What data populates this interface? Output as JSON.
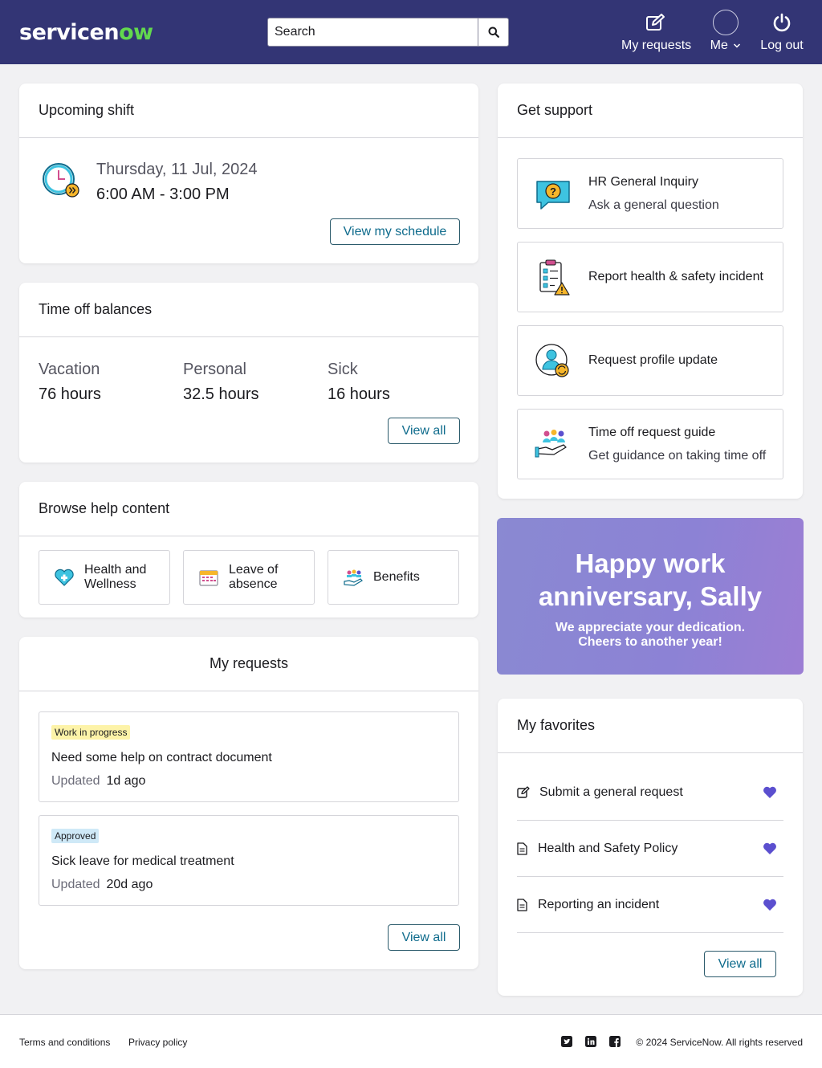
{
  "header": {
    "logo_main": "servicen",
    "logo_accent": "ow",
    "search_placeholder": "Search",
    "my_requests_label": "My requests",
    "me_label": "Me",
    "logout_label": "Log out"
  },
  "upcoming_shift": {
    "title": "Upcoming shift",
    "date": "Thursday, 11 Jul, 2024",
    "time": "6:00 AM - 3:00 PM",
    "button": "View my schedule"
  },
  "time_off": {
    "title": "Time off balances",
    "balances": [
      {
        "type": "Vacation",
        "value": "76 hours"
      },
      {
        "type": "Personal",
        "value": "32.5 hours"
      },
      {
        "type": "Sick",
        "value": "16 hours"
      }
    ],
    "button": "View all"
  },
  "help_content": {
    "title": "Browse help content",
    "tiles": [
      {
        "label": "Health and Wellness",
        "icon": "heart-health-icon"
      },
      {
        "label": "Leave of absence",
        "icon": "calendar-icon"
      },
      {
        "label": "Benefits",
        "icon": "benefits-icon"
      }
    ]
  },
  "my_requests": {
    "title": "My requests",
    "items": [
      {
        "status": "Work in progress",
        "title": "Need some help on contract document",
        "updated_label": "Updated",
        "updated": "1d ago"
      },
      {
        "status": "Approved",
        "title": "Sick leave for medical treatment",
        "updated_label": "Updated",
        "updated": "20d ago"
      }
    ],
    "button": "View all"
  },
  "get_support": {
    "title": "Get support",
    "items": [
      {
        "title": "HR General Inquiry",
        "subtitle": "Ask a general question",
        "icon": "question-chat-icon"
      },
      {
        "title": "Report health & safety incident",
        "subtitle": "",
        "icon": "checklist-warning-icon"
      },
      {
        "title": "Request profile update",
        "subtitle": "",
        "icon": "profile-update-icon"
      },
      {
        "title": "Time off request guide",
        "subtitle": "Get guidance on taking time off",
        "icon": "hand-people-icon"
      }
    ]
  },
  "banner": {
    "headline": "Happy work anniversary, Sally",
    "message_line1": "We appreciate your dedication.",
    "message_line2": "Cheers to another year!"
  },
  "favorites": {
    "title": "My favorites",
    "items": [
      {
        "label": "Submit a general request",
        "icon": "edit-icon"
      },
      {
        "label": "Health and Safety Policy",
        "icon": "document-icon"
      },
      {
        "label": "Reporting an incident",
        "icon": "document-icon"
      }
    ],
    "button": "View all"
  },
  "footer": {
    "terms": "Terms and conditions",
    "privacy": "Privacy policy",
    "copyright": "© 2024 ServiceNow.  All rights reserved"
  },
  "colors": {
    "header_bg": "#333575",
    "accent_teal": "#0e6b8c",
    "heart": "#5b4fcf",
    "logo_green": "#62d84e"
  }
}
